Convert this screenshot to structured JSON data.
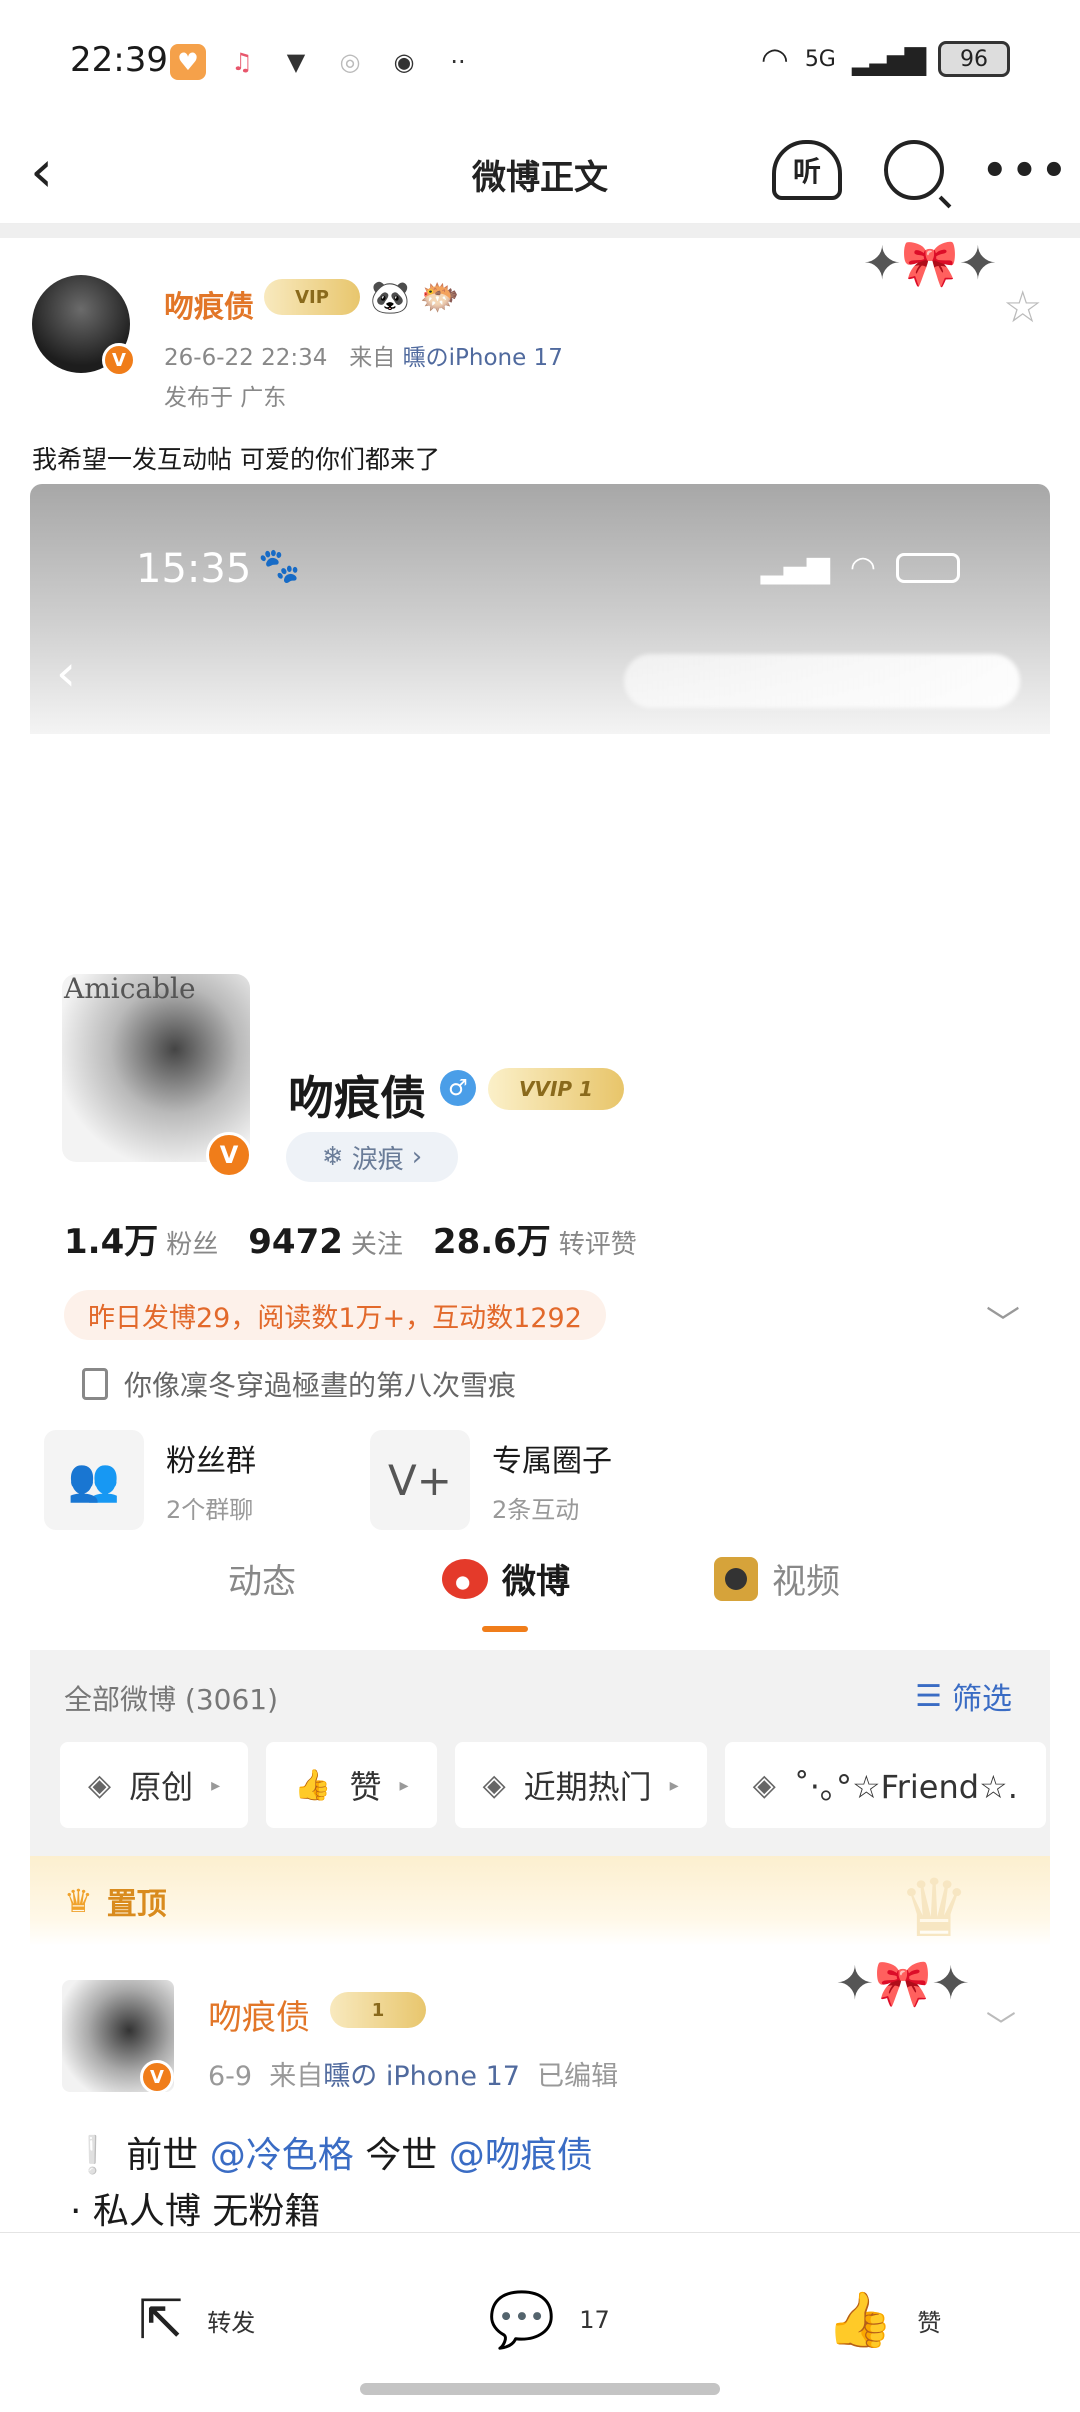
{
  "status_bar": {
    "time": "22:39",
    "apps": [
      "heart-app",
      "music-app",
      "paint-app",
      "camera-app",
      "wechat"
    ],
    "more": "··",
    "network": "5G",
    "battery": "96"
  },
  "nav": {
    "title": "微博正文",
    "listen_label": "听"
  },
  "post": {
    "author": "吻痕债",
    "timestamp": "26-6-22 22:34",
    "source_prefix": "来自",
    "source": "曛のiPhone 17",
    "location": "发布于 广东",
    "text": "我希望一发互动帖 可爱的你们都来了"
  },
  "embed": {
    "status_time": "15:35",
    "profile": {
      "name": "吻痕债",
      "avatar_text": "Amicable",
      "vip_label": "VVIP 1",
      "tag": "淚痕",
      "stats": [
        {
          "value": "1.4万",
          "label": "粉丝"
        },
        {
          "value": "9472",
          "label": "关注"
        },
        {
          "value": "28.6万",
          "label": "转评赞"
        }
      ],
      "notice": "昨日发博29，阅读数1万+，互动数1292",
      "bio": "你像凜冬穿過極晝的第八次雪痕",
      "features": [
        {
          "title": "粉丝群",
          "subtitle": "2个群聊"
        },
        {
          "title": "专属圈子",
          "subtitle": "2条互动"
        }
      ]
    },
    "tabs": [
      "动态",
      "微博",
      "视频"
    ],
    "feed": {
      "all_label": "全部微博 (3061)",
      "filter_label": "筛选",
      "chips": [
        "原创",
        "赞",
        "近期热门",
        "˚‧｡°☆Friend☆."
      ],
      "pinned_label": "置顶",
      "card": {
        "author": "吻痕债",
        "vip_label": "1",
        "date": "6-9",
        "source_prefix": "来自",
        "source": "曛の iPhone 17",
        "edited": "已编辑",
        "line1_prefix": "前世",
        "mention1": "@冷色格",
        "line1_mid": "今世",
        "mention2": "@吻痕债",
        "line2": "· 私人博 无粉籍"
      }
    }
  },
  "actions": {
    "repost_label": "转发",
    "comment_count": "17",
    "like_label": "赞"
  },
  "colors": {
    "accent_orange": "#e27628",
    "link_blue": "#3a6cc4",
    "notice_bg": "#fdf1ea"
  }
}
